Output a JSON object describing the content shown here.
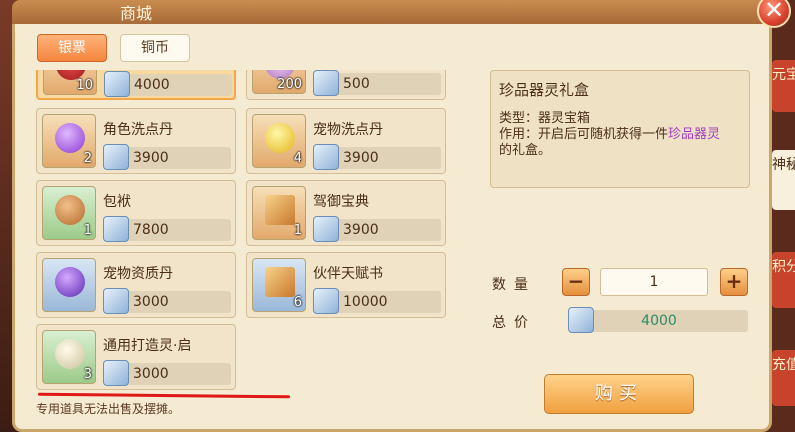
{
  "window": {
    "title": "商城"
  },
  "tabs": [
    {
      "label": "银票",
      "active": true
    },
    {
      "label": "铜币",
      "active": false
    }
  ],
  "side_tabs": [
    {
      "label": "元宝"
    },
    {
      "label": "神秘"
    },
    {
      "label": "积分"
    },
    {
      "label": "充值"
    }
  ],
  "items": [
    {
      "name": "",
      "qty": "10",
      "price": "4000",
      "selected": true
    },
    {
      "name": "",
      "qty": "200",
      "price": "500"
    },
    {
      "name": "角色洗点丹",
      "qty": "2",
      "price": "3900"
    },
    {
      "name": "宠物洗点丹",
      "qty": "4",
      "price": "3900"
    },
    {
      "name": "包袱",
      "qty": "1",
      "price": "7800"
    },
    {
      "name": "驾御宝典",
      "qty": "1",
      "price": "3900"
    },
    {
      "name": "宠物资质丹",
      "qty": "",
      "price": "3000"
    },
    {
      "name": "伙伴天赋书",
      "qty": "6",
      "price": "10000"
    },
    {
      "name": "通用打造灵·启",
      "qty": "3",
      "price": "3000"
    }
  ],
  "note": "专用道具无法出售及摆摊。",
  "detail": {
    "title": "珍品器灵礼盒",
    "type_line": "类型：器灵宝箱",
    "use_prefix": "作用：开启后可随机获得一件",
    "use_highlight": "珍品器灵",
    "use_suffix": "的礼盒。"
  },
  "purchase": {
    "quantity_label": "数量",
    "quantity_value": "1",
    "total_label": "总价",
    "total_value": "4000",
    "minus": "−",
    "plus": "+",
    "buy_label": "购买"
  },
  "colors": {
    "highlight": "#a33cc2",
    "accent": "#f0a040"
  }
}
